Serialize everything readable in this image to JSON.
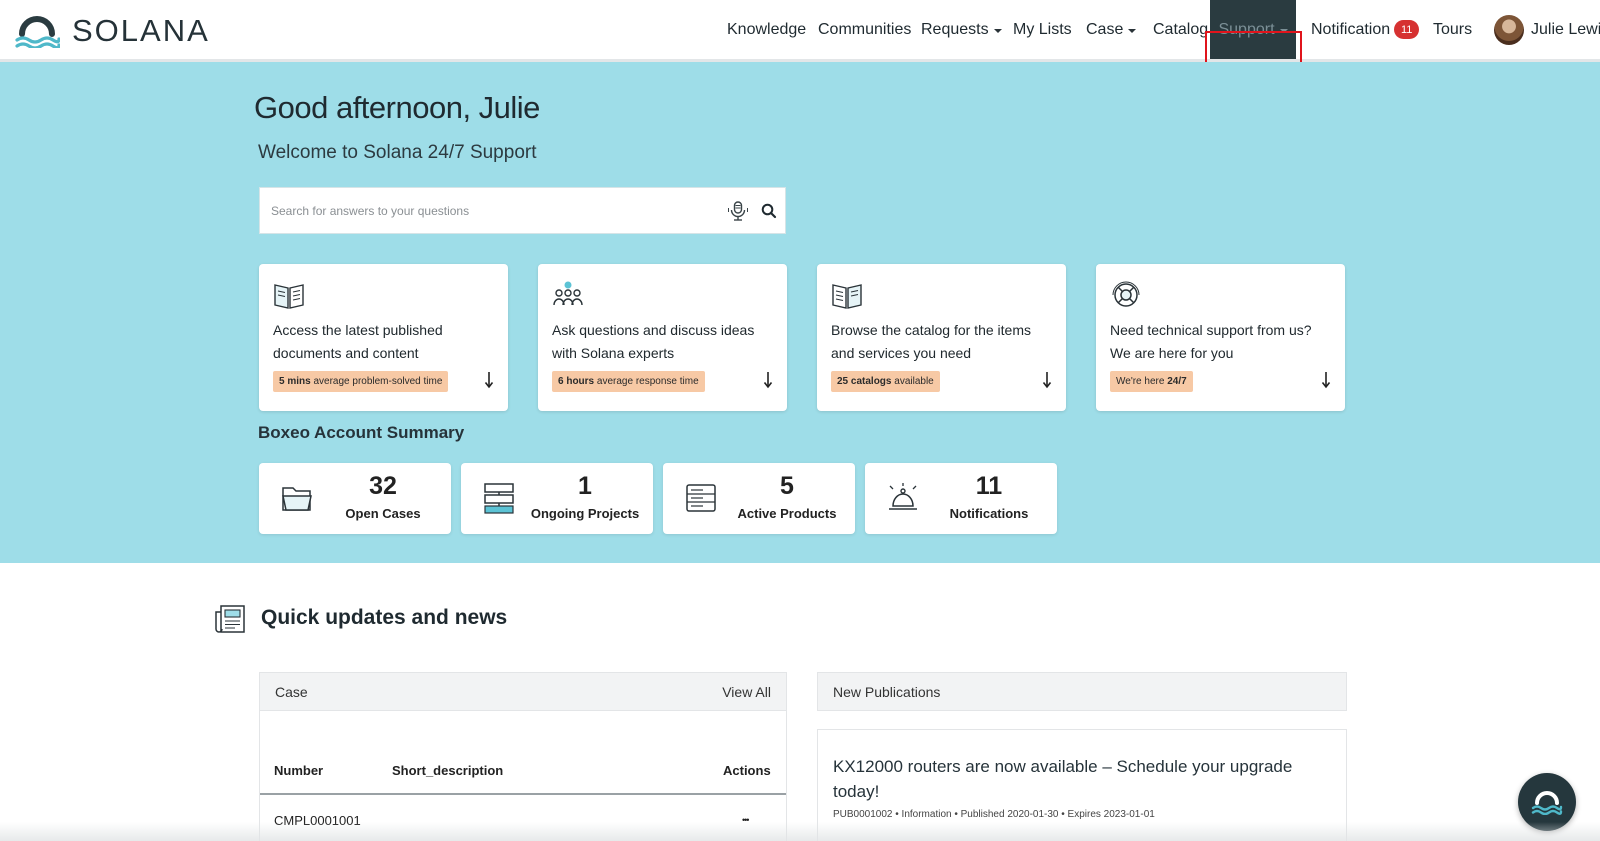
{
  "brand": {
    "name": "SOLANA"
  },
  "nav": {
    "knowledge": "Knowledge",
    "communities": "Communities",
    "requests": "Requests",
    "my_lists": "My Lists",
    "case": "Case",
    "catalog": "Catalog",
    "support": "Support",
    "notification": "Notification",
    "notification_count": "11",
    "tours": "Tours",
    "user_name": "Julie Lewis"
  },
  "hero": {
    "greeting": "Good afternoon, Julie",
    "welcome": "Welcome to Solana 24/7 Support",
    "search_placeholder": "Search for answers to your questions"
  },
  "cards": [
    {
      "icon": "book-icon",
      "text": "Access the latest published documents and content",
      "tag_bold": "5 mins",
      "tag_rest": " average problem-solved time"
    },
    {
      "icon": "community-icon",
      "text": "Ask questions and discuss ideas with Solana experts",
      "tag_bold": "6 hours",
      "tag_rest": " average response time"
    },
    {
      "icon": "catalog-icon",
      "text": "Browse the catalog for the items and services you need",
      "tag_bold": "25 catalogs",
      "tag_rest": " available"
    },
    {
      "icon": "lifebuoy-icon",
      "text": "Need technical support from us? We are here for you",
      "tag_pre": "We're here ",
      "tag_bold": "24/7"
    }
  ],
  "summary": {
    "title": "Boxeo Account Summary",
    "stats": [
      {
        "icon": "folder-icon",
        "value": "32",
        "label": "Open Cases"
      },
      {
        "icon": "projects-icon",
        "value": "1",
        "label": "Ongoing Projects"
      },
      {
        "icon": "server-icon",
        "value": "5",
        "label": "Active Products"
      },
      {
        "icon": "bell-icon",
        "value": "11",
        "label": "Notifications"
      }
    ]
  },
  "updates": {
    "title": "Quick updates and news",
    "case_panel": {
      "label": "Case",
      "view_all": "View All",
      "columns": [
        "Number",
        "Short_description",
        "Actions"
      ],
      "rows": [
        {
          "number": "CMPL0001001",
          "short_description": "",
          "actions": "•••"
        }
      ]
    },
    "pub_panel": {
      "label": "New Publications",
      "items": [
        {
          "title": "KX12000 routers are now available – Schedule your upgrade today!",
          "meta": "PUB0001002 • Information • Published 2020-01-30 • Expires 2023-01-01"
        }
      ]
    }
  },
  "colors": {
    "hero_bg": "#9edde8",
    "active_nav_bg": "#2a3b40",
    "badge": "#d63131",
    "tag_bg": "#f7c9a5",
    "highlight": "#e0141c"
  }
}
